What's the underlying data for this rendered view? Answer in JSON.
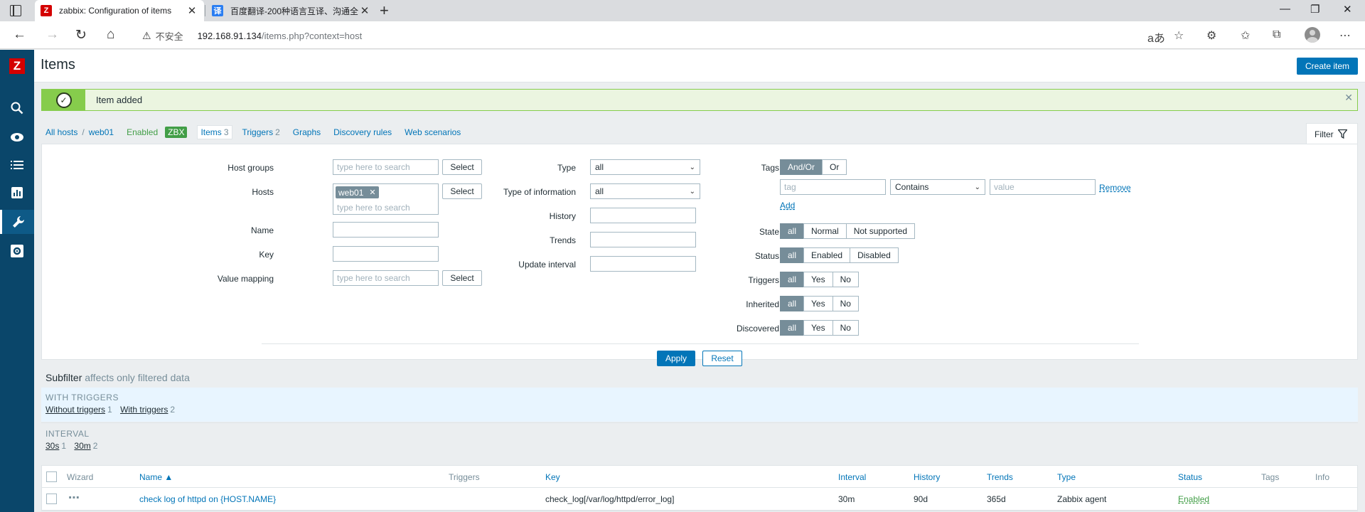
{
  "browser": {
    "tabs": [
      {
        "label": "zabbix: Configuration of items",
        "favicon": "Z",
        "favicon_color": "#d40000"
      },
      {
        "label": "百度翻译-200种语言互译、沟通全",
        "favicon": "译",
        "favicon_color": "#2b7ef2"
      }
    ],
    "url_warning": "不安全",
    "url_host": "192.168.91.134",
    "url_path": "/items.php?context=host"
  },
  "app": {
    "logo": "Z",
    "page_title": "Items",
    "create_button": "Create item",
    "message": "Item added"
  },
  "breadcrumbs": {
    "all_hosts": "All hosts",
    "host": "web01",
    "enabled": "Enabled",
    "zbx": "ZBX",
    "items": "Items",
    "items_count": "3",
    "triggers": "Triggers",
    "triggers_count": "2",
    "graphs": "Graphs",
    "discovery": "Discovery rules",
    "web": "Web scenarios"
  },
  "filter": {
    "tab_label": "Filter",
    "host_groups_label": "Host groups",
    "hosts_label": "Hosts",
    "name_label": "Name",
    "key_label": "Key",
    "value_mapping_label": "Value mapping",
    "search_placeholder": "type here to search",
    "select_label": "Select",
    "host_chip": "web01",
    "type_label": "Type",
    "type_value": "all",
    "type_info_label": "Type of information",
    "type_info_value": "all",
    "history_label": "History",
    "trends_label": "Trends",
    "update_interval_label": "Update interval",
    "tags_label": "Tags",
    "tags_andor": "And/Or",
    "tags_or": "Or",
    "tag_placeholder": "tag",
    "tag_operator": "Contains",
    "value_placeholder": "value",
    "remove_label": "Remove",
    "add_label": "Add",
    "state_label": "State",
    "state_options": [
      "all",
      "Normal",
      "Not supported"
    ],
    "status_label": "Status",
    "status_options": [
      "all",
      "Enabled",
      "Disabled"
    ],
    "triggers_label": "Triggers",
    "inherited_label": "Inherited",
    "discovered_label": "Discovered",
    "yesno_options": [
      "all",
      "Yes",
      "No"
    ],
    "apply": "Apply",
    "reset": "Reset"
  },
  "subfilter": {
    "title": "Subfilter",
    "note": "affects only filtered data",
    "groups": [
      {
        "heading": "WITH TRIGGERS",
        "options": [
          {
            "label": "Without triggers",
            "count": "1"
          },
          {
            "label": "With triggers",
            "count": "2"
          }
        ]
      },
      {
        "heading": "INTERVAL",
        "options": [
          {
            "label": "30s",
            "count": "1"
          },
          {
            "label": "30m",
            "count": "2"
          }
        ]
      }
    ]
  },
  "table": {
    "headers": {
      "wizard": "Wizard",
      "name": "Name ▲",
      "triggers": "Triggers",
      "key": "Key",
      "interval": "Interval",
      "history": "History",
      "trends": "Trends",
      "type": "Type",
      "status": "Status",
      "tags": "Tags",
      "info": "Info"
    },
    "rows": [
      {
        "name": "check log of httpd on {HOST.NAME}",
        "key": "check_log[/var/log/httpd/error_log]",
        "interval": "30m",
        "history": "90d",
        "trends": "365d",
        "type": "Zabbix agent",
        "status": "Enabled"
      }
    ]
  }
}
